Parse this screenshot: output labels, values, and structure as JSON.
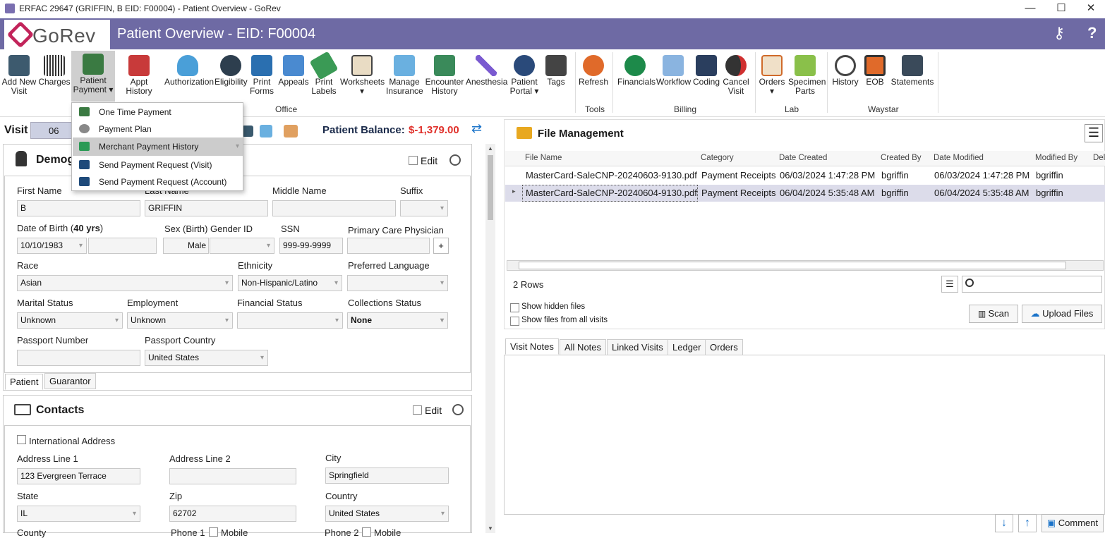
{
  "window": {
    "title": "ERFAC 29647 (GRIFFIN, B EID: F00004) - Patient Overview - GoRev",
    "minimize": "—",
    "maximize": "☐",
    "close": "✕"
  },
  "header": {
    "logo": "GoRev",
    "title": "Patient Overview - EID: F00004",
    "keys_icon": "⚷",
    "help_icon": "?"
  },
  "ribbon": {
    "buttons": [
      "Add New Visit",
      "Charges",
      "Patient Payment",
      "Appt History",
      "Authorization",
      "Eligibility",
      "Print Forms",
      "Appeals",
      "Print Labels",
      "Worksheets",
      "Manage Insurance",
      "Encounter History",
      "Anesthesia",
      "Patient Portal",
      "Tags",
      "Refresh",
      "Financials",
      "Workflow",
      "Coding",
      "Cancel Visit",
      "Orders",
      "Specimen Parts",
      "History",
      "EOB",
      "Statements"
    ],
    "groups": {
      "office": "Office",
      "tools": "Tools",
      "billing": "Billing",
      "lab": "Lab",
      "waystar": "Waystar"
    }
  },
  "dropdown": {
    "items": [
      "One Time Payment",
      "Payment Plan",
      "Merchant Payment History",
      "Send Payment Request (Visit)",
      "Send Payment Request (Account)"
    ],
    "selected": "Merchant Payment History"
  },
  "visit": {
    "label": "Visit",
    "date_prefix": "06",
    "balance_label": "Patient Balance:",
    "balance_value": "$-1,379.00"
  },
  "demographics": {
    "title": "Demog",
    "edit": "Edit",
    "first_name_label": "First Name",
    "first_name": "B",
    "last_name_label": "Last Name",
    "last_name": "GRIFFIN",
    "middle_name_label": "Middle Name",
    "suffix_label": "Suffix",
    "dob_label": "Date of Birth (",
    "age": "40 yrs",
    "dob_close": ")",
    "dob": "10/10/1983",
    "sex_label": "Sex (Birth)",
    "sex": "Male",
    "gender_label": "Gender ID",
    "ssn_label": "SSN",
    "ssn": "999-99-9999",
    "pcp_label": "Primary Care Physician",
    "pcp_add": "+",
    "race_label": "Race",
    "race": "Asian",
    "ethnicity_label": "Ethnicity",
    "ethnicity": "Non-Hispanic/Latino",
    "language_label": "Preferred Language",
    "marital_label": "Marital Status",
    "marital": "Unknown",
    "employment_label": "Employment",
    "employment": "Unknown",
    "financial_label": "Financial Status",
    "collections_label": "Collections Status",
    "collections": "None",
    "passport_label": "Passport Number",
    "country_label": "Passport Country",
    "country": "United States",
    "tab_patient": "Patient",
    "tab_guarantor": "Guarantor"
  },
  "contacts": {
    "title": "Contacts",
    "edit": "Edit",
    "intl": "International Address",
    "addr1_label": "Address Line 1",
    "addr1": "123 Evergreen Terrace",
    "addr2_label": "Address Line 2",
    "city_label": "City",
    "city": "Springfield",
    "state_label": "State",
    "state": "IL",
    "zip_label": "Zip",
    "zip": "62702",
    "country_label": "Country",
    "country": "United States",
    "county_label": "County",
    "phone1_label": "Phone 1",
    "phone1_type": "Mobile",
    "phone2_label": "Phone 2",
    "phone2_type": "Mobile"
  },
  "files": {
    "title": "File Management",
    "columns": [
      "File Name",
      "Category",
      "Date Created",
      "Created By",
      "Date Modified",
      "Modified By",
      "Del"
    ],
    "rows": [
      [
        "MasterCard-SaleCNP-20240603-9130.pdf",
        "Payment Receipts",
        "06/03/2024 1:47:28 PM",
        "bgriffin",
        "06/03/2024 1:47:28 PM",
        "bgriffin"
      ],
      [
        "MasterCard-SaleCNP-20240604-9130.pdf",
        "Payment Receipts",
        "06/04/2024 5:35:48 AM",
        "bgriffin",
        "06/04/2024 5:35:48 AM",
        "bgriffin"
      ]
    ],
    "row_count": "2 Rows",
    "show_hidden": "Show hidden files",
    "show_all": "Show files from all visits",
    "scan": "Scan",
    "upload": "Upload Files"
  },
  "notes": {
    "tabs": [
      "Visit Notes",
      "All Notes",
      "Linked Visits",
      "Ledger",
      "Orders"
    ],
    "comment": "Comment"
  },
  "colors": {
    "header": "#6e6aa4",
    "balance": "#e0312b",
    "accent": "#1a73c9"
  }
}
